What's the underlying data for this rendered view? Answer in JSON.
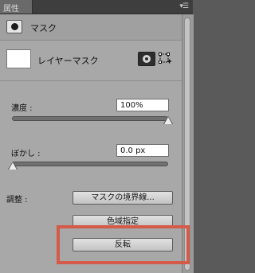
{
  "panel": {
    "tab_label": "属性",
    "menu_icon": "panel-menu-icon"
  },
  "header": {
    "icon": "layer-mask-icon",
    "title": "マスク"
  },
  "mask": {
    "label": "レイヤーマスク",
    "pixel_mask_icon": "pixel-mask-icon",
    "vector_mask_icon": "vector-mask-add-icon"
  },
  "density": {
    "label": "濃度 :",
    "value": "100%",
    "level": 1.0
  },
  "feather": {
    "label": "ぼかし :",
    "value": "0.0 px",
    "level": 0.0
  },
  "refine": {
    "label": "調整 :",
    "mask_edge_button": "マスクの境界線...",
    "color_range_button": "色域指定",
    "invert_button": "反転"
  },
  "colors": {
    "highlight": "#d45a4a",
    "panel_bg": "#a8a8a8"
  }
}
